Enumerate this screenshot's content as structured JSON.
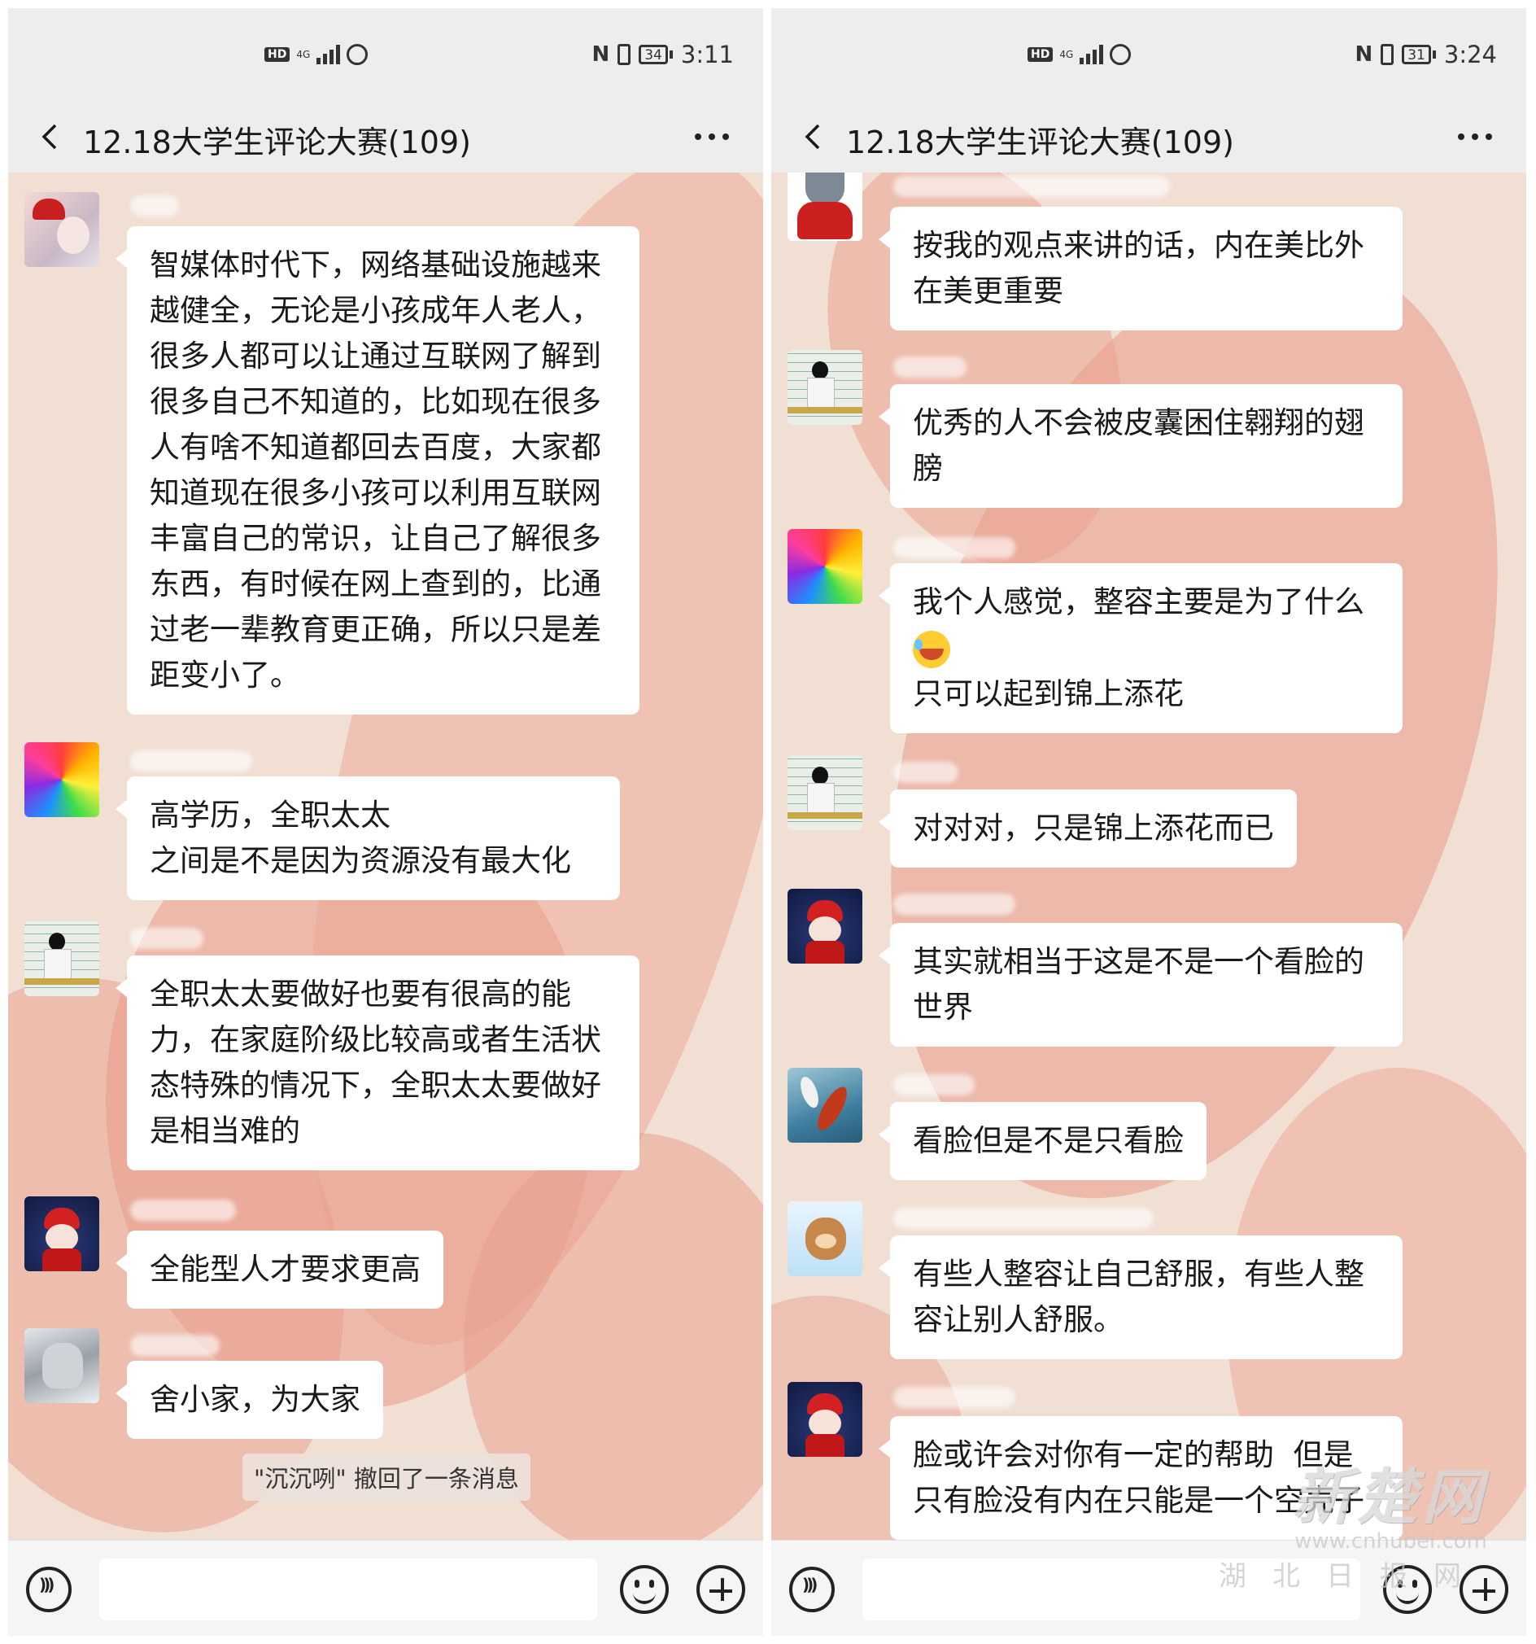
{
  "left": {
    "status": {
      "hd": "HD",
      "network": "4G",
      "battery": "34",
      "time": "3:11"
    },
    "title": "12.18大学生评论大赛(109)",
    "messages": [
      {
        "text": "智媒体时代下，网络基础设施越来\n越健全，无论是小孩成年人老人，\n很多人都可以让通过互联网了解到\n很多自己不知道的，比如现在很多\n人有啥不知道都回去百度，大家都\n知道现在很多小孩可以利用互联网\n丰富自己的常识，让自己了解很多\n东西，有时候在网上查到的，比通\n过老一辈教育更正确，所以只是差\n距变小了。"
      },
      {
        "text": "高学历，全职太太\n之间是不是因为资源没有最大化"
      },
      {
        "text": "全职太太要做好也要有很高的能\n力，在家庭阶级比较高或者生活状\n态特殊的情况下，全职太太要做好\n是相当难的"
      },
      {
        "text": "全能型人才要求更高"
      },
      {
        "text": "舍小家，为大家"
      }
    ],
    "system_notice": "\"沉沉咧\" 撤回了一条消息"
  },
  "right": {
    "status": {
      "hd": "HD",
      "network": "4G",
      "battery": "31",
      "time": "3:24"
    },
    "title": "12.18大学生评论大赛(109)",
    "messages": [
      {
        "text": "按我的观点来讲的话，内在美比外\n在美更重要"
      },
      {
        "text": "优秀的人不会被皮囊困住翱翔的翅\n膀"
      },
      {
        "line1": "我个人感觉，整容主要是为了什么",
        "line2": "只可以起到锦上添花"
      },
      {
        "text": "对对对，只是锦上添花而已"
      },
      {
        "text": "其实就相当于这是不是一个看脸的\n世界"
      },
      {
        "text": "看脸但是不是只看脸"
      },
      {
        "text": "有些人整容让自己舒服，有些人整\n容让别人舒服。"
      },
      {
        "text": "脸或许会对你有一定的帮助  但是\n只有脸没有内在只能是一个空壳子"
      }
    ]
  },
  "watermark": {
    "logo": "新楚网",
    "url": "www.cnhubei.com",
    "sub": "湖北日报网"
  },
  "colors": {
    "chat_bg": "#f1dfd4",
    "heart": "#e9a08e",
    "bubble": "#ffffff",
    "bar": "#ededed"
  }
}
